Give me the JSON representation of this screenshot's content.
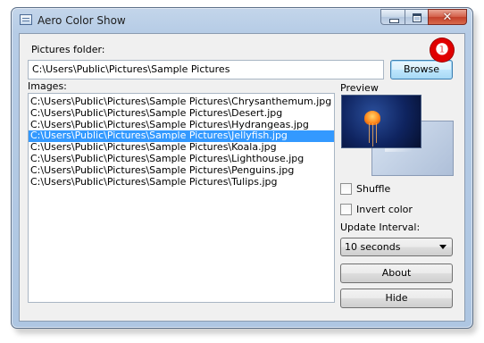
{
  "window": {
    "title": "Aero Color Show"
  },
  "folder": {
    "label": "Pictures folder:",
    "value": "C:\\Users\\Public\\Pictures\\Sample Pictures",
    "browse_label": "Browse"
  },
  "badge": {
    "text": "❶"
  },
  "images": {
    "label": "Images:",
    "items": [
      "C:\\Users\\Public\\Pictures\\Sample Pictures\\Chrysanthemum.jpg",
      "C:\\Users\\Public\\Pictures\\Sample Pictures\\Desert.jpg",
      "C:\\Users\\Public\\Pictures\\Sample Pictures\\Hydrangeas.jpg",
      "C:\\Users\\Public\\Pictures\\Sample Pictures\\Jellyfish.jpg",
      "C:\\Users\\Public\\Pictures\\Sample Pictures\\Koala.jpg",
      "C:\\Users\\Public\\Pictures\\Sample Pictures\\Lighthouse.jpg",
      "C:\\Users\\Public\\Pictures\\Sample Pictures\\Penguins.jpg",
      "C:\\Users\\Public\\Pictures\\Sample Pictures\\Tulips.jpg"
    ],
    "selected_index": 3
  },
  "preview": {
    "label": "Preview"
  },
  "options": {
    "shuffle_label": "Shuffle",
    "shuffle_checked": false,
    "invert_label": "Invert color",
    "invert_checked": false,
    "interval_label": "Update Interval:",
    "interval_value": "10 seconds"
  },
  "actions": {
    "about_label": "About",
    "hide_label": "Hide"
  },
  "colors": {
    "selection": "#3399ff",
    "badge": "#e00000"
  }
}
